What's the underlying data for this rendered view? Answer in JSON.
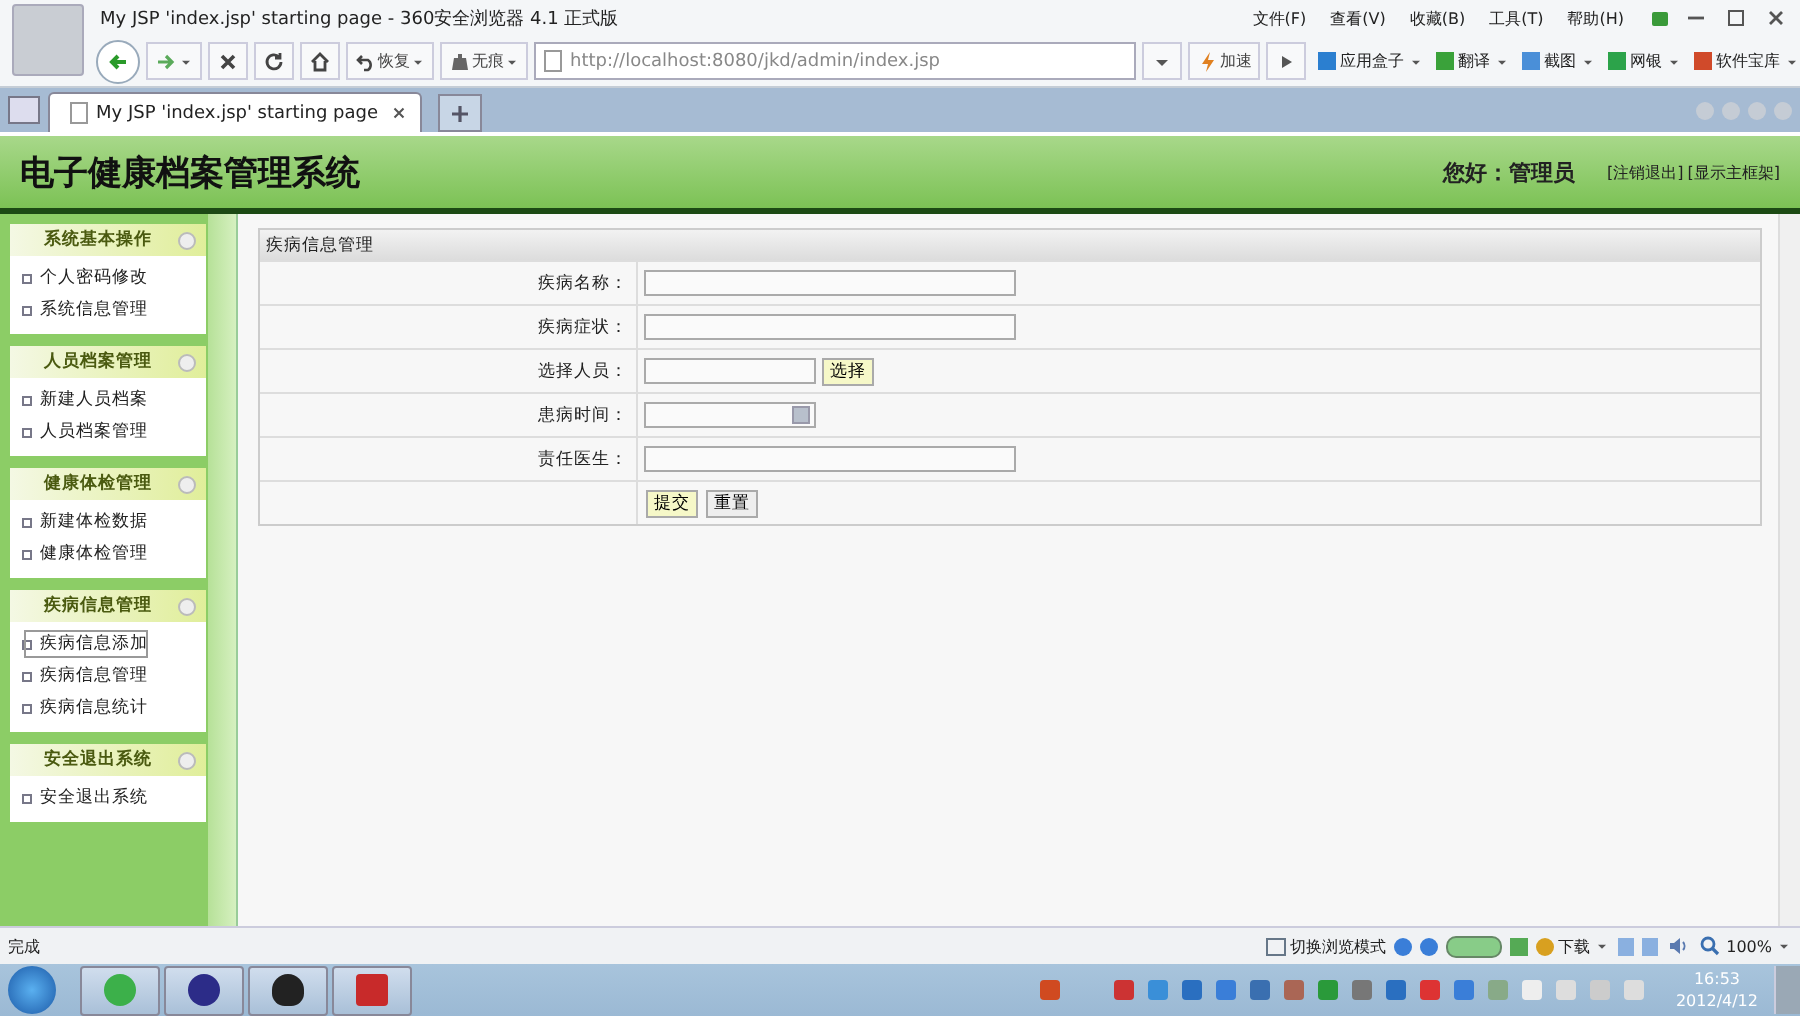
{
  "window": {
    "title": "My JSP 'index.jsp' starting page - 360安全浏览器 4.1 正式版"
  },
  "menu": [
    "文件(F)",
    "查看(V)",
    "收藏(B)",
    "工具(T)",
    "帮助(H)"
  ],
  "toolbar": {
    "restore": "恢复",
    "incognito": "无痕",
    "address": "http://localhost:8080/jkd/admin/index.jsp",
    "speedup": "加速",
    "tools": [
      "应用盒子",
      "翻译",
      "截图",
      "网银",
      "软件宝库"
    ]
  },
  "tabs": [
    {
      "label": "My JSP 'index.jsp' starting page",
      "selected": true
    }
  ],
  "header": {
    "title": "电子健康档案管理系统",
    "greeting": "您好：管理员",
    "links": [
      "[注销退出]",
      "[显示主框架]"
    ]
  },
  "sidebar": {
    "groups": [
      {
        "title": "系统基本操作",
        "items": [
          {
            "label": "个人密码修改",
            "selected": false
          },
          {
            "label": "系统信息管理",
            "selected": false
          }
        ]
      },
      {
        "title": "人员档案管理",
        "items": [
          {
            "label": "新建人员档案",
            "selected": false
          },
          {
            "label": "人员档案管理",
            "selected": false
          }
        ]
      },
      {
        "title": "健康体检管理",
        "items": [
          {
            "label": "新建体检数据",
            "selected": false
          },
          {
            "label": "健康体检管理",
            "selected": false
          }
        ]
      },
      {
        "title": "疾病信息管理",
        "items": [
          {
            "label": "疾病信息添加",
            "selected": true
          },
          {
            "label": "疾病信息管理",
            "selected": false
          },
          {
            "label": "疾病信息统计",
            "selected": false
          }
        ]
      },
      {
        "title": "安全退出系统",
        "items": [
          {
            "label": "安全退出系统",
            "selected": false
          }
        ]
      }
    ]
  },
  "form": {
    "title": "疾病信息管理",
    "fields": [
      {
        "label": "疾病名称：",
        "kind": "text"
      },
      {
        "label": "疾病症状：",
        "kind": "text"
      },
      {
        "label": "选择人员：",
        "kind": "picker",
        "button": "选择"
      },
      {
        "label": "患病时间：",
        "kind": "date"
      },
      {
        "label": "责任医生：",
        "kind": "text"
      }
    ],
    "buttons": [
      "提交",
      "重置"
    ]
  },
  "status_bar": {
    "text": "完成",
    "mode": "切换浏览模式",
    "download": "下载",
    "zoom": "100%"
  },
  "taskbar": {
    "time": "16:53",
    "date": "2012/4/12"
  }
}
